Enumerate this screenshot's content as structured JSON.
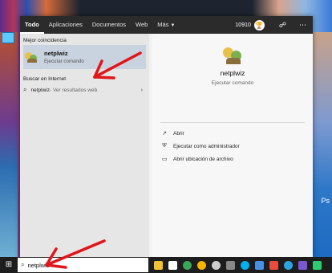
{
  "tabs": [
    {
      "label": "Todo",
      "active": true
    },
    {
      "label": "Aplicaciones"
    },
    {
      "label": "Documentos"
    },
    {
      "label": "Web"
    },
    {
      "label": "Más"
    }
  ],
  "points": "10910",
  "best_match": {
    "section_title": "Mejor coincidencia",
    "name": "netplwiz",
    "subtitle": "Ejecutar comando"
  },
  "web": {
    "section_title": "Buscar en Internet",
    "query": "netplwiz",
    "hint": " - Ver resultados web"
  },
  "detail": {
    "name": "netplwiz",
    "subtitle": "Ejecutar comando",
    "actions": [
      {
        "label": "Abrir",
        "icon": "open-icon"
      },
      {
        "label": "Ejecutar como administrador",
        "icon": "admin-shield-icon"
      },
      {
        "label": "Abrir ubicación de archivo",
        "icon": "folder-icon"
      }
    ]
  },
  "taskbar": {
    "search_value": "netplwiz",
    "icons": [
      "task-view-icon",
      "file-explorer-icon",
      "store-icon",
      "chrome-icon",
      "chrome-canary-icon",
      "search-app-icon",
      "settings-icon",
      "skype-icon",
      "app-icon-1",
      "app-icon-2",
      "telegram-icon",
      "app-icon-3",
      "app-icon-4"
    ]
  },
  "desktop": {
    "right_label": "Ps"
  },
  "colors": {
    "topbar": "#2b2b2b",
    "selected": "#c8d3df",
    "arrow": "#e0161b",
    "taskbar": "#1d1d1d"
  }
}
